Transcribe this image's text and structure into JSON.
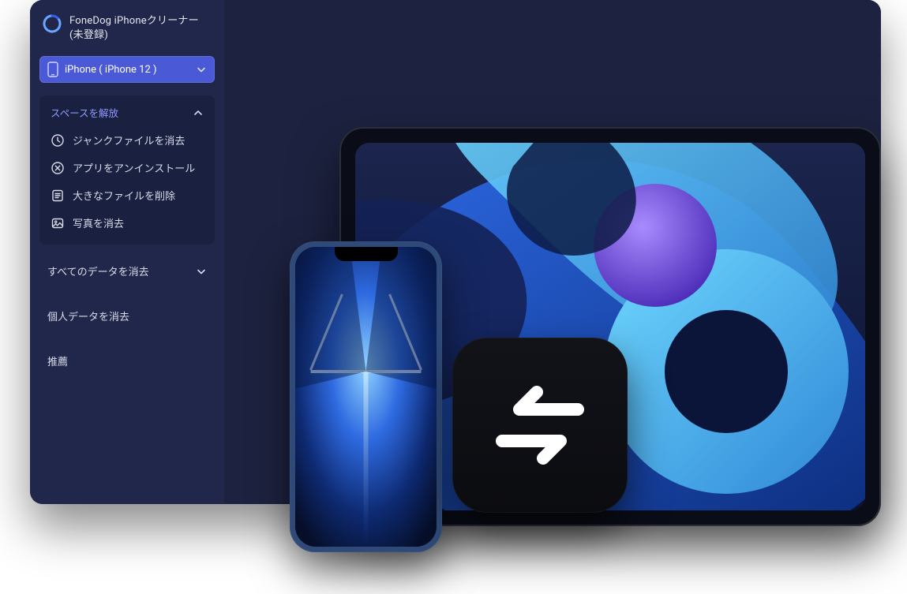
{
  "app": {
    "title": "FoneDog iPhoneクリーナー\n(未登録)"
  },
  "device_select": {
    "label": "iPhone ( iPhone 12 )"
  },
  "sidebar": {
    "section_free_space": {
      "title": "スペースを解放",
      "expanded": true,
      "items": [
        {
          "label": "ジャンクファイルを消去",
          "icon": "clock-icon"
        },
        {
          "label": "アプリをアンインストール",
          "icon": "remove-app-icon"
        },
        {
          "label": "大きなファイルを削除",
          "icon": "list-file-icon"
        },
        {
          "label": "写真を消去",
          "icon": "photo-icon"
        }
      ]
    },
    "erase_all": {
      "label": "すべてのデータを消去"
    },
    "erase_private": {
      "label": "個人データを消去"
    },
    "recommend": {
      "label": "推薦"
    }
  },
  "colors": {
    "accent": "#4a5ad6",
    "sidebar_bg": "#21274a",
    "window_bg": "#1d2240",
    "section_title": "#8e99ff"
  }
}
